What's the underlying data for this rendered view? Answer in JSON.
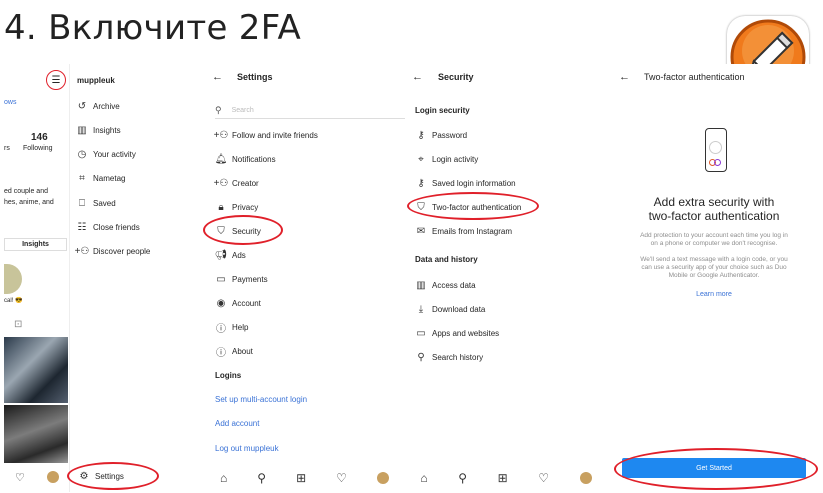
{
  "page_title": "4. Включите 2FA",
  "panel1": {
    "username": "muppleuk",
    "left_link": "ows",
    "stat_value": "146",
    "stat_label": "Following",
    "stat_left": "rs",
    "bio_line1": "ed couple and",
    "bio_line2": "hes, anime, and",
    "insights_button": "Insights",
    "caption": "cal! 😎",
    "menu": [
      "Archive",
      "Insights",
      "Your activity",
      "Nametag",
      "Saved",
      "Close friends",
      "Discover people"
    ],
    "settings": "Settings"
  },
  "panel2": {
    "header": "Settings",
    "search_placeholder": "Search",
    "items": [
      "Follow and invite friends",
      "Notifications",
      "Creator",
      "Privacy",
      "Security",
      "Ads",
      "Payments",
      "Account",
      "Help",
      "About"
    ],
    "logins_header": "Logins",
    "login_links": [
      "Set up multi-account login",
      "Add account",
      "Log out muppleuk"
    ]
  },
  "panel3": {
    "header": "Security",
    "login_security_header": "Login security",
    "login_items": [
      "Password",
      "Login activity",
      "Saved login information",
      "Two-factor authentication",
      "Emails from Instagram"
    ],
    "data_header": "Data and history",
    "data_items": [
      "Access data",
      "Download data",
      "Apps and websites",
      "Search history"
    ]
  },
  "panel4": {
    "header": "Two-factor authentication",
    "heading_line1": "Add extra security with",
    "heading_line2": "two-factor authentication",
    "desc1_line1": "Add protection to your account each time you log in",
    "desc1_line2": "on a phone or computer we don't recognise.",
    "desc2_line1": "We'll send a text message with a login code, or you",
    "desc2_line2": "can use a security app of your choice such as Duo",
    "desc2_line3": "Mobile or Google Authenticator.",
    "learn_more": "Learn more",
    "button": "Get Started"
  },
  "colors": {
    "highlight": "#e0202a",
    "link": "#3a72d6",
    "button": "#1e88f0"
  }
}
